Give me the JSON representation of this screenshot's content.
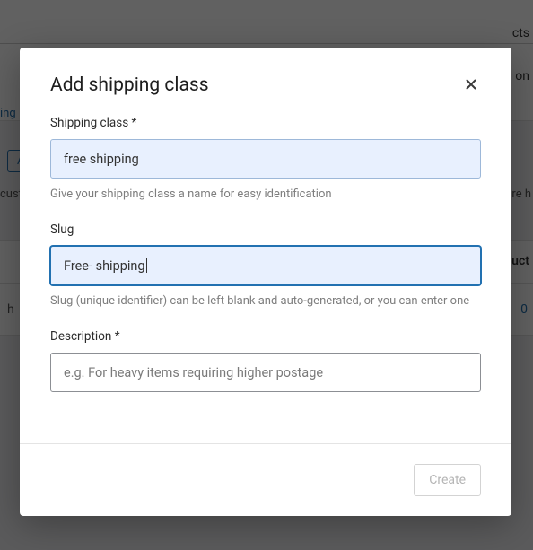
{
  "background": {
    "link_fragment": "ing",
    "button_fragment": "A",
    "text_left": "cust",
    "text_right_top": "cts",
    "text_right_on": "on",
    "text_right_ire": "ire h",
    "text_right_uct": "uct",
    "count": "0",
    "row_left": "h"
  },
  "modal": {
    "title": "Add shipping class",
    "fields": {
      "name": {
        "label": "Shipping class *",
        "value": "free shipping",
        "help": "Give your shipping class a name for easy identification"
      },
      "slug": {
        "label": "Slug",
        "value": "Free- shipping",
        "help": "Slug (unique identifier) can be left blank and auto-generated, or you can enter one"
      },
      "description": {
        "label": "Description *",
        "placeholder": "e.g. For heavy items requiring higher postage"
      }
    },
    "footer": {
      "create": "Create"
    }
  }
}
